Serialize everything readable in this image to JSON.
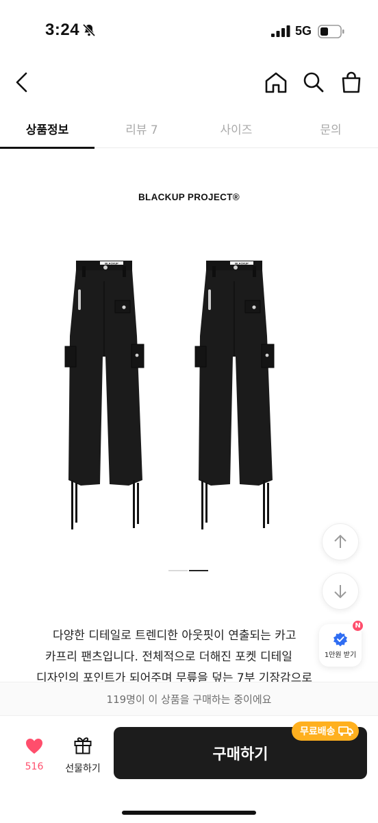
{
  "status_bar": {
    "time": "3:24",
    "network": "5G"
  },
  "header": {
    "icons": [
      "back-arrow-icon",
      "home-icon",
      "search-icon",
      "shopping-bag-icon"
    ]
  },
  "tabs": [
    {
      "label": "상품정보",
      "active": true
    },
    {
      "label": "리뷰 7",
      "active": false
    },
    {
      "label": "사이즈",
      "active": false
    },
    {
      "label": "문의",
      "active": false
    }
  ],
  "product": {
    "brand_logo": "BLACKUP PROJECT®",
    "image_alt_icon": "cargo-capri-pants-image",
    "carousel": {
      "count": 2,
      "active_index": 1
    },
    "description_lines": [
      "다양한 디테일로 트렌디한 아웃핏이 연출되는 카고",
      "카프리 팬츠입니다. 전체적으로 더해진 포켓 디테일",
      "디자인의 포인트가 되어주며 무릎을 덮는 7부 기장감으로"
    ]
  },
  "floating": {
    "scroll_up_icon": "arrow-up-icon",
    "scroll_down_icon": "arrow-down-icon",
    "coupon_label": "1만원 받기",
    "coupon_badge": "N"
  },
  "notice": {
    "text": "119명이 이 상품을 구매하는 중이에요"
  },
  "bottom_bar": {
    "like_count": "516",
    "gift_label": "선물하기",
    "buy_label": "구매하기",
    "shipping_badge": "무료배송"
  },
  "colors": {
    "accent_pink": "#ff4e6c",
    "shipping_orange": "#ffb01f",
    "buy_button": "#1c1c1c"
  }
}
